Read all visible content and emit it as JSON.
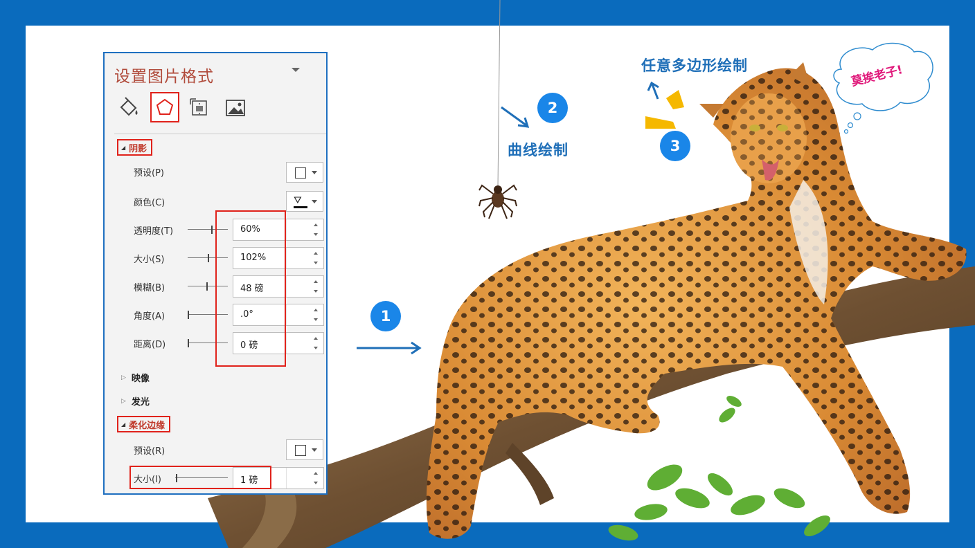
{
  "panel": {
    "title": "设置图片格式",
    "tabs": [
      {
        "name": "填充与线条",
        "icon": "paint-bucket-icon"
      },
      {
        "name": "效果",
        "icon": "pentagon-icon",
        "selected": true
      },
      {
        "name": "大小与属性",
        "icon": "size-properties-icon"
      },
      {
        "name": "图片",
        "icon": "picture-icon"
      }
    ],
    "shadow": {
      "heading": "阴影",
      "preset_label": "预设(P)",
      "color_label": "颜色(C)",
      "transparency_label": "透明度(T)",
      "transparency_value": "60%",
      "transparency_level": 0.6,
      "size_label": "大小(S)",
      "size_value": "102%",
      "size_level": 0.51,
      "blur_label": "模糊(B)",
      "blur_value": "48 磅",
      "blur_level": 0.48,
      "angle_label": "角度(A)",
      "angle_value": ".0°",
      "angle_level": 0,
      "distance_label": "距离(D)",
      "distance_value": "0 磅",
      "distance_level": 0
    },
    "reflection": {
      "heading": "映像"
    },
    "glow": {
      "heading": "发光"
    },
    "soft_edges": {
      "heading": "柔化边缘",
      "preset_label": "预设(R)",
      "size_label": "大小(I)",
      "size_value": "1 磅",
      "size_level": 0.02
    }
  },
  "annotations": {
    "step1": "1",
    "step2": "2",
    "step3": "3",
    "curve_label": "曲线绘制",
    "freeform_label": "任意多边形绘制",
    "speech_bubble": "莫挨老子!"
  },
  "colors": {
    "frame_blue": "#0a6bbd",
    "badge_blue": "#1a86e8",
    "highlight_red": "#e0221b",
    "bubble_pink": "#e0187a"
  }
}
